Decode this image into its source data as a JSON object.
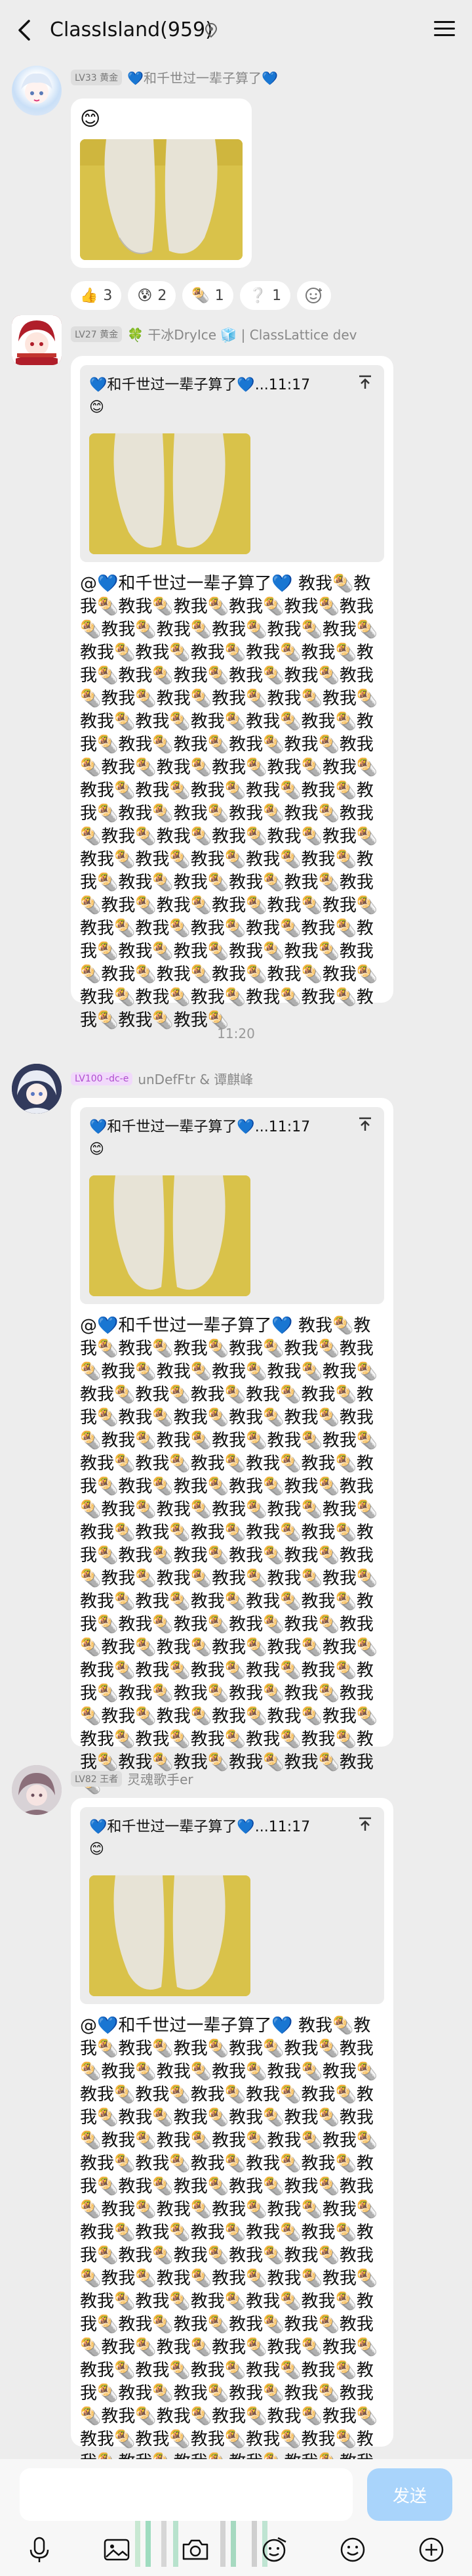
{
  "header": {
    "title": "ClassIsland(959)"
  },
  "messages": [
    {
      "level": "LV33 黄金",
      "name": "💙和千世过一辈子算了💙",
      "emoji": "😊"
    },
    {
      "level": "LV27 黄金",
      "name": "🍀 干冰DryIce 🧊 | ClassLattice dev",
      "quote_head": "💙和千世过一辈子算了💙...11:17",
      "quote_emoji": "😊",
      "text": "@💙和千世过一辈子算了💙 教我🌯教我🌯教我🌯教我🌯教我🌯教我🌯教我🌯教我🌯教我🌯教我🌯教我🌯教我🌯教我🌯教我🌯教我🌯教我🌯教我🌯教我🌯教我🌯教我🌯教我🌯教我🌯教我🌯教我🌯教我🌯教我🌯教我🌯教我🌯教我🌯教我🌯教我🌯教我🌯教我🌯教我🌯教我🌯教我🌯教我🌯教我🌯教我🌯教我🌯教我🌯教我🌯教我🌯教我🌯教我🌯教我🌯教我🌯教我🌯教我🌯教我🌯教我🌯教我🌯教我🌯教我🌯教我🌯教我🌯教我🌯教我🌯教我🌯教我🌯教我🌯教我🌯教我🌯教我🌯教我🌯教我🌯教我🌯教我🌯教我🌯教我🌯教我🌯教我🌯教我🌯教我🌯教我🌯教我🌯教我🌯教我🌯教我🌯教我🌯教我🌯教我🌯教我🌯教我🌯教我🌯教我🌯教我🌯教我🌯教我🌯教我🌯教我🌯教我🌯教我🌯教我🌯教我🌯教我🌯教我🌯教我🌯教我🌯教我🌯"
    },
    {
      "level": "LV100 -dc-e",
      "name": "unDefFtr & 谭麒峰",
      "quote_head": "💙和千世过一辈子算了💙...11:17",
      "quote_emoji": "😊",
      "text": "@💙和千世过一辈子算了💙 教我🌯教我🌯教我🌯教我🌯教我🌯教我🌯教我🌯教我🌯教我🌯教我🌯教我🌯教我🌯教我🌯教我🌯教我🌯教我🌯教我🌯教我🌯教我🌯教我🌯教我🌯教我🌯教我🌯教我🌯教我🌯教我🌯教我🌯教我🌯教我🌯教我🌯教我🌯教我🌯教我🌯教我🌯教我🌯教我🌯教我🌯教我🌯教我🌯教我🌯教我🌯教我🌯教我🌯教我🌯教我🌯教我🌯教我🌯教我🌯教我🌯教我🌯教我🌯教我🌯教我🌯教我🌯教我🌯教我🌯教我🌯教我🌯教我🌯教我🌯教我🌯教我🌯教我🌯教我🌯教我🌯教我🌯教我🌯教我🌯教我🌯教我🌯教我🌯教我🌯教我🌯教我🌯教我🌯教我🌯教我🌯教我🌯教我🌯教我🌯教我🌯教我🌯教我🌯教我🌯教我🌯教我🌯教我🌯教我🌯教我🌯教我🌯教我🌯教我🌯教我🌯教我🌯教我🌯教我🌯教我🌯教我🌯教我🌯教我🌯教我🌯教我🌯教我🌯"
    },
    {
      "level": "LV82 王者",
      "name": "灵魂歌手er",
      "quote_head": "💙和千世过一辈子算了💙...11:17",
      "quote_emoji": "😊",
      "text": "@💙和千世过一辈子算了💙 教我🌯教我🌯教我🌯教我🌯教我🌯教我🌯教我🌯教我🌯教我🌯教我🌯教我🌯教我🌯教我🌯教我🌯教我🌯教我🌯教我🌯教我🌯教我🌯教我🌯教我🌯教我🌯教我🌯教我🌯教我🌯教我🌯教我🌯教我🌯教我🌯教我🌯教我🌯教我🌯教我🌯教我🌯教我🌯教我🌯教我🌯教我🌯教我🌯教我🌯教我🌯教我🌯教我🌯教我🌯教我🌯教我🌯教我🌯教我🌯教我🌯教我🌯教我🌯教我🌯教我🌯教我🌯教我🌯教我🌯教我🌯教我🌯教我🌯教我🌯教我🌯教我🌯教我🌯教我🌯教我🌯教我🌯教我🌯教我🌯教我🌯教我🌯教我🌯教我🌯教我🌯教我🌯教我🌯教我🌯教我🌯教我🌯教我🌯教我🌯教我🌯教我🌯教我🌯教我🌯教我🌯教我🌯教我🌯教我🌯教我🌯教我🌯教我🌯教我🌯教我🌯教我🌯教我🌯教我🌯教我🌯教我🌯教我🌯教我🌯教我🌯教我🌯教我🌯教我🌯教我🌯"
    }
  ],
  "reactions": [
    {
      "emoji": "👍",
      "count": "3"
    },
    {
      "emoji": "😰",
      "count": "2"
    },
    {
      "emoji": "🌯",
      "count": "1"
    },
    {
      "emoji": "❔",
      "count": "1"
    }
  ],
  "time_separator": "11:20",
  "input": {
    "send_label": "发送"
  }
}
